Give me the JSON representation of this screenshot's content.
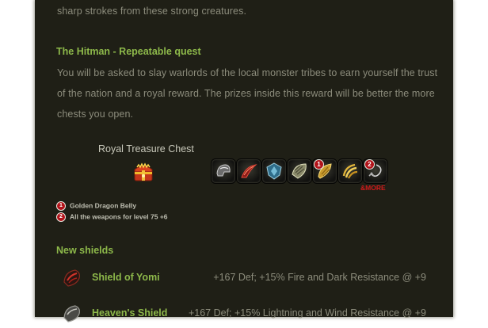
{
  "intro": {
    "tail": "sharp strokes from these strong creatures."
  },
  "hitman": {
    "title": "The Hitman - Repeatable quest",
    "lines": [
      "You will be asked to slay warlords of the local monster tribes to earn yourself the trust",
      "of the nation and a royal reward. The prizes inside this reward will be better the more",
      "chests you open."
    ]
  },
  "chest": {
    "title": "Royal Treasure Chest",
    "icon": "treasure-chest-icon",
    "rewards": [
      {
        "icon": "helmet-icon",
        "badge": ""
      },
      {
        "icon": "red-blade-icon",
        "badge": ""
      },
      {
        "icon": "blue-shield-icon",
        "badge": ""
      },
      {
        "icon": "armor-piece-icon",
        "badge": ""
      },
      {
        "icon": "golden-belly-icon",
        "badge": "1"
      },
      {
        "icon": "golden-claws-icon",
        "badge": ""
      },
      {
        "icon": "weapons-icon",
        "badge": "2"
      }
    ],
    "more": "&MORE"
  },
  "legend": [
    {
      "badge": "1",
      "label": "Golden Dragon Belly"
    },
    {
      "badge": "2",
      "label": "All the weapons for level 75 +6"
    }
  ],
  "shields": {
    "title": "New shields",
    "items": [
      {
        "name": "Shield of Yomi",
        "stats": "+167 Def; +15% Fire and Dark Resistance @ +9",
        "icon": "dark-shield-icon"
      },
      {
        "name": "Heaven's Shield",
        "stats": "+167 Def; +15% Lightning and Wind Resistance @ +9",
        "icon": "grey-shield-icon"
      }
    ]
  },
  "colors": {
    "panel_bg": "#1f1f16",
    "heading": "#8db84a",
    "body_text": "#8c8c7c",
    "badge": "#b2131a",
    "more": "#d01b1b"
  }
}
